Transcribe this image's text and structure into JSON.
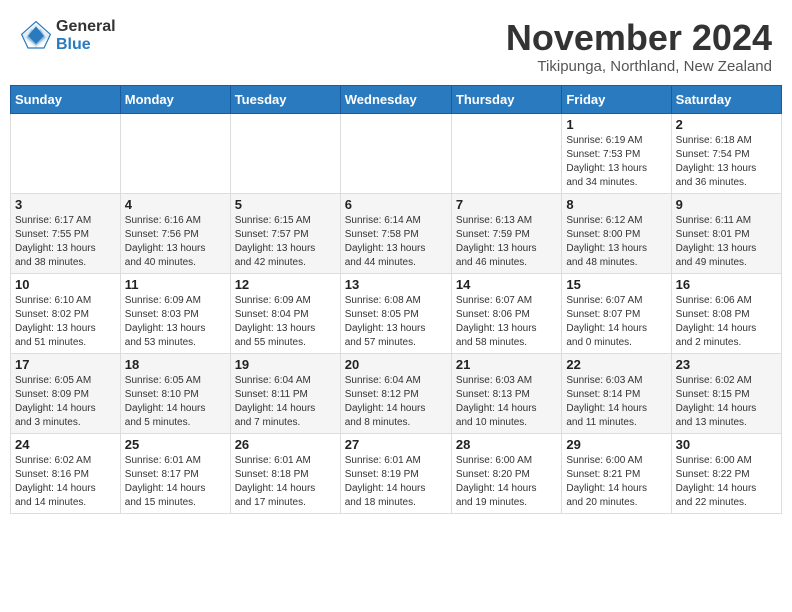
{
  "header": {
    "logo_general": "General",
    "logo_blue": "Blue",
    "month_title": "November 2024",
    "location": "Tikipunga, Northland, New Zealand"
  },
  "weekdays": [
    "Sunday",
    "Monday",
    "Tuesday",
    "Wednesday",
    "Thursday",
    "Friday",
    "Saturday"
  ],
  "weeks": [
    [
      {
        "day": "",
        "info": ""
      },
      {
        "day": "",
        "info": ""
      },
      {
        "day": "",
        "info": ""
      },
      {
        "day": "",
        "info": ""
      },
      {
        "day": "",
        "info": ""
      },
      {
        "day": "1",
        "info": "Sunrise: 6:19 AM\nSunset: 7:53 PM\nDaylight: 13 hours\nand 34 minutes."
      },
      {
        "day": "2",
        "info": "Sunrise: 6:18 AM\nSunset: 7:54 PM\nDaylight: 13 hours\nand 36 minutes."
      }
    ],
    [
      {
        "day": "3",
        "info": "Sunrise: 6:17 AM\nSunset: 7:55 PM\nDaylight: 13 hours\nand 38 minutes."
      },
      {
        "day": "4",
        "info": "Sunrise: 6:16 AM\nSunset: 7:56 PM\nDaylight: 13 hours\nand 40 minutes."
      },
      {
        "day": "5",
        "info": "Sunrise: 6:15 AM\nSunset: 7:57 PM\nDaylight: 13 hours\nand 42 minutes."
      },
      {
        "day": "6",
        "info": "Sunrise: 6:14 AM\nSunset: 7:58 PM\nDaylight: 13 hours\nand 44 minutes."
      },
      {
        "day": "7",
        "info": "Sunrise: 6:13 AM\nSunset: 7:59 PM\nDaylight: 13 hours\nand 46 minutes."
      },
      {
        "day": "8",
        "info": "Sunrise: 6:12 AM\nSunset: 8:00 PM\nDaylight: 13 hours\nand 48 minutes."
      },
      {
        "day": "9",
        "info": "Sunrise: 6:11 AM\nSunset: 8:01 PM\nDaylight: 13 hours\nand 49 minutes."
      }
    ],
    [
      {
        "day": "10",
        "info": "Sunrise: 6:10 AM\nSunset: 8:02 PM\nDaylight: 13 hours\nand 51 minutes."
      },
      {
        "day": "11",
        "info": "Sunrise: 6:09 AM\nSunset: 8:03 PM\nDaylight: 13 hours\nand 53 minutes."
      },
      {
        "day": "12",
        "info": "Sunrise: 6:09 AM\nSunset: 8:04 PM\nDaylight: 13 hours\nand 55 minutes."
      },
      {
        "day": "13",
        "info": "Sunrise: 6:08 AM\nSunset: 8:05 PM\nDaylight: 13 hours\nand 57 minutes."
      },
      {
        "day": "14",
        "info": "Sunrise: 6:07 AM\nSunset: 8:06 PM\nDaylight: 13 hours\nand 58 minutes."
      },
      {
        "day": "15",
        "info": "Sunrise: 6:07 AM\nSunset: 8:07 PM\nDaylight: 14 hours\nand 0 minutes."
      },
      {
        "day": "16",
        "info": "Sunrise: 6:06 AM\nSunset: 8:08 PM\nDaylight: 14 hours\nand 2 minutes."
      }
    ],
    [
      {
        "day": "17",
        "info": "Sunrise: 6:05 AM\nSunset: 8:09 PM\nDaylight: 14 hours\nand 3 minutes."
      },
      {
        "day": "18",
        "info": "Sunrise: 6:05 AM\nSunset: 8:10 PM\nDaylight: 14 hours\nand 5 minutes."
      },
      {
        "day": "19",
        "info": "Sunrise: 6:04 AM\nSunset: 8:11 PM\nDaylight: 14 hours\nand 7 minutes."
      },
      {
        "day": "20",
        "info": "Sunrise: 6:04 AM\nSunset: 8:12 PM\nDaylight: 14 hours\nand 8 minutes."
      },
      {
        "day": "21",
        "info": "Sunrise: 6:03 AM\nSunset: 8:13 PM\nDaylight: 14 hours\nand 10 minutes."
      },
      {
        "day": "22",
        "info": "Sunrise: 6:03 AM\nSunset: 8:14 PM\nDaylight: 14 hours\nand 11 minutes."
      },
      {
        "day": "23",
        "info": "Sunrise: 6:02 AM\nSunset: 8:15 PM\nDaylight: 14 hours\nand 13 minutes."
      }
    ],
    [
      {
        "day": "24",
        "info": "Sunrise: 6:02 AM\nSunset: 8:16 PM\nDaylight: 14 hours\nand 14 minutes."
      },
      {
        "day": "25",
        "info": "Sunrise: 6:01 AM\nSunset: 8:17 PM\nDaylight: 14 hours\nand 15 minutes."
      },
      {
        "day": "26",
        "info": "Sunrise: 6:01 AM\nSunset: 8:18 PM\nDaylight: 14 hours\nand 17 minutes."
      },
      {
        "day": "27",
        "info": "Sunrise: 6:01 AM\nSunset: 8:19 PM\nDaylight: 14 hours\nand 18 minutes."
      },
      {
        "day": "28",
        "info": "Sunrise: 6:00 AM\nSunset: 8:20 PM\nDaylight: 14 hours\nand 19 minutes."
      },
      {
        "day": "29",
        "info": "Sunrise: 6:00 AM\nSunset: 8:21 PM\nDaylight: 14 hours\nand 20 minutes."
      },
      {
        "day": "30",
        "info": "Sunrise: 6:00 AM\nSunset: 8:22 PM\nDaylight: 14 hours\nand 22 minutes."
      }
    ]
  ]
}
